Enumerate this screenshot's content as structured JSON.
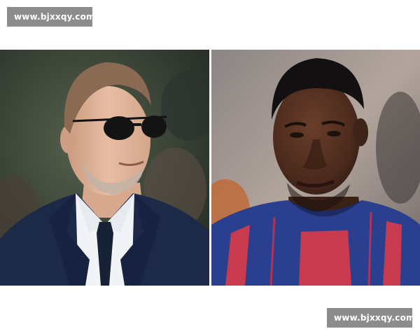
{
  "watermarks": {
    "top": "www.bjxxqy.com",
    "bottom": "www.bjxxqy.com"
  },
  "photos": {
    "left": {
      "subject": "older man with grey stubble, dark sunglasses, navy suit, white shirt and dark tie",
      "colors": {
        "suit": "#1c2a48",
        "shirt": "#f1f3f6",
        "tie": "#172236",
        "skin": "#e3b79c",
        "hair": "#8a6a52",
        "background": "#3e4a3a"
      }
    },
    "right": {
      "subject": "young man with short dark hair in a blue and red striped football shirt",
      "colors": {
        "shirt_blue": "#2b3f8f",
        "shirt_red": "#c83a4e",
        "skin": "#4a2a1c",
        "background": "#a59892"
      }
    }
  }
}
